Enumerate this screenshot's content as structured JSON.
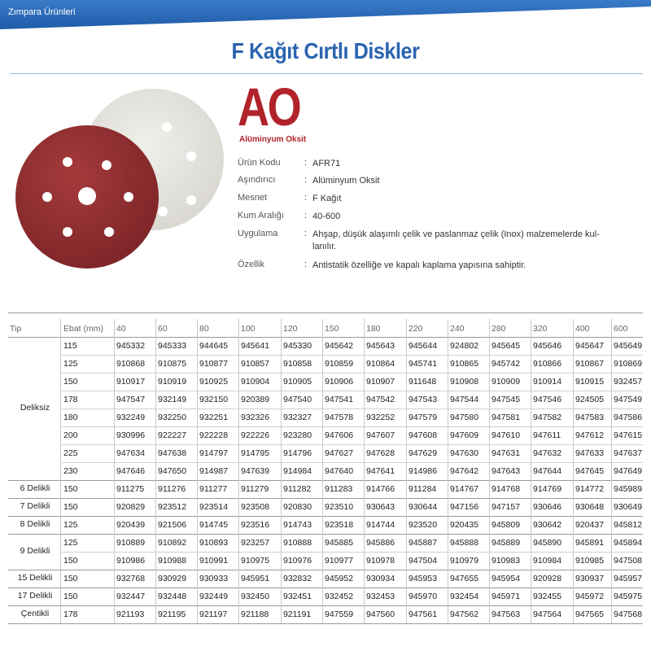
{
  "header": {
    "section": "Zımpara Ürünleri"
  },
  "title": "F Kağıt Cırtlı Diskler",
  "product": {
    "code_big": "AO",
    "code_sub": "Alüminyum Oksit",
    "specs": [
      {
        "key": "Ürün Kodu",
        "value": "AFR71"
      },
      {
        "key": "Aşındırıcı",
        "value": "Alüminyum Oksit"
      },
      {
        "key": "Mesnet",
        "value": "F Kağıt"
      },
      {
        "key": "Kum Aralığı",
        "value": "40-600"
      },
      {
        "key": "Uygulama",
        "value": "Ahşap, düşük alaşımlı çelik ve paslanmaz çelik (Inox) malzemelerde kul-",
        "value2": "lanılır."
      },
      {
        "key": "Özellik",
        "value": "Antistatik özelliğe ve kapalı kaplama yapısına sahiptir."
      }
    ],
    "colors": {
      "accent": "#2a64b0",
      "brand_red": "#b1232b",
      "disc_red": "#8e2b2e",
      "disc_white": "#e4e2dc"
    }
  },
  "table": {
    "headers": [
      "Tip",
      "Ebat (mm)",
      "40",
      "60",
      "80",
      "100",
      "120",
      "150",
      "180",
      "220",
      "240",
      "280",
      "320",
      "400",
      "600"
    ],
    "groups": [
      {
        "type": "Deliksiz",
        "rows": [
          {
            "size": "115",
            "codes": [
              "945332",
              "945333",
              "944645",
              "945641",
              "945330",
              "945642",
              "945643",
              "945644",
              "924802",
              "945645",
              "945646",
              "945647",
              "945649"
            ]
          },
          {
            "size": "125",
            "codes": [
              "910868",
              "910875",
              "910877",
              "910857",
              "910858",
              "910859",
              "910864",
              "945741",
              "910865",
              "945742",
              "910866",
              "910867",
              "910869"
            ]
          },
          {
            "size": "150",
            "codes": [
              "910917",
              "910919",
              "910925",
              "910904",
              "910905",
              "910906",
              "910907",
              "911648",
              "910908",
              "910909",
              "910914",
              "910915",
              "932457"
            ]
          },
          {
            "size": "178",
            "codes": [
              "947547",
              "932149",
              "932150",
              "920389",
              "947540",
              "947541",
              "947542",
              "947543",
              "947544",
              "947545",
              "947546",
              "924505",
              "947549"
            ]
          },
          {
            "size": "180",
            "codes": [
              "932249",
              "932250",
              "932251",
              "932326",
              "932327",
              "947578",
              "932252",
              "947579",
              "947580",
              "947581",
              "947582",
              "947583",
              "947586"
            ]
          },
          {
            "size": "200",
            "codes": [
              "930996",
              "922227",
              "922228",
              "922226",
              "923280",
              "947606",
              "947607",
              "947608",
              "947609",
              "947610",
              "947611",
              "947612",
              "947615"
            ]
          },
          {
            "size": "225",
            "codes": [
              "947634",
              "947638",
              "914797",
              "914795",
              "914796",
              "947627",
              "947628",
              "947629",
              "947630",
              "947631",
              "947632",
              "947633",
              "947637"
            ]
          },
          {
            "size": "230",
            "codes": [
              "947646",
              "947650",
              "914987",
              "947639",
              "914984",
              "947640",
              "947641",
              "914986",
              "947642",
              "947643",
              "947644",
              "947645",
              "947649"
            ]
          }
        ]
      },
      {
        "type": "6 Delikli",
        "rows": [
          {
            "size": "150",
            "codes": [
              "911275",
              "911276",
              "911277",
              "911279",
              "911282",
              "911283",
              "914766",
              "911284",
              "914767",
              "914768",
              "914769",
              "914772",
              "945989"
            ]
          }
        ]
      },
      {
        "type": "7 Delikli",
        "rows": [
          {
            "size": "150",
            "codes": [
              "920829",
              "923512",
              "923514",
              "923508",
              "920830",
              "923510",
              "930643",
              "930644",
              "947156",
              "947157",
              "930646",
              "930648",
              "930649"
            ]
          }
        ]
      },
      {
        "type": "8 Delikli",
        "rows": [
          {
            "size": "125",
            "codes": [
              "920439",
              "921506",
              "914745",
              "923516",
              "914743",
              "923518",
              "914744",
              "923520",
              "920435",
              "945809",
              "930642",
              "920437",
              "945812"
            ]
          }
        ]
      },
      {
        "type": "9 Delikli",
        "rows": [
          {
            "size": "125",
            "codes": [
              "910889",
              "910892",
              "910893",
              "923257",
              "910888",
              "945885",
              "945886",
              "945887",
              "945888",
              "945889",
              "945890",
              "945891",
              "945894"
            ]
          },
          {
            "size": "150",
            "codes": [
              "910986",
              "910988",
              "910991",
              "910975",
              "910976",
              "910977",
              "910978",
              "947504",
              "910979",
              "910983",
              "910984",
              "910985",
              "947508"
            ]
          }
        ]
      },
      {
        "type": "15 Delikli",
        "rows": [
          {
            "size": "150",
            "codes": [
              "932768",
              "930929",
              "930933",
              "945951",
              "932832",
              "945952",
              "930934",
              "945953",
              "947655",
              "945954",
              "920928",
              "930937",
              "945957"
            ]
          }
        ]
      },
      {
        "type": "17 Delikli",
        "rows": [
          {
            "size": "150",
            "codes": [
              "932447",
              "932448",
              "932449",
              "932450",
              "932451",
              "932452",
              "932453",
              "945970",
              "932454",
              "945971",
              "932455",
              "945972",
              "945975"
            ]
          }
        ]
      },
      {
        "type": "Çentikli",
        "rows": [
          {
            "size": "178",
            "codes": [
              "921193",
              "921195",
              "921197",
              "921188",
              "921191",
              "947559",
              "947560",
              "947561",
              "947562",
              "947563",
              "947564",
              "947565",
              "947568"
            ]
          }
        ]
      }
    ]
  }
}
